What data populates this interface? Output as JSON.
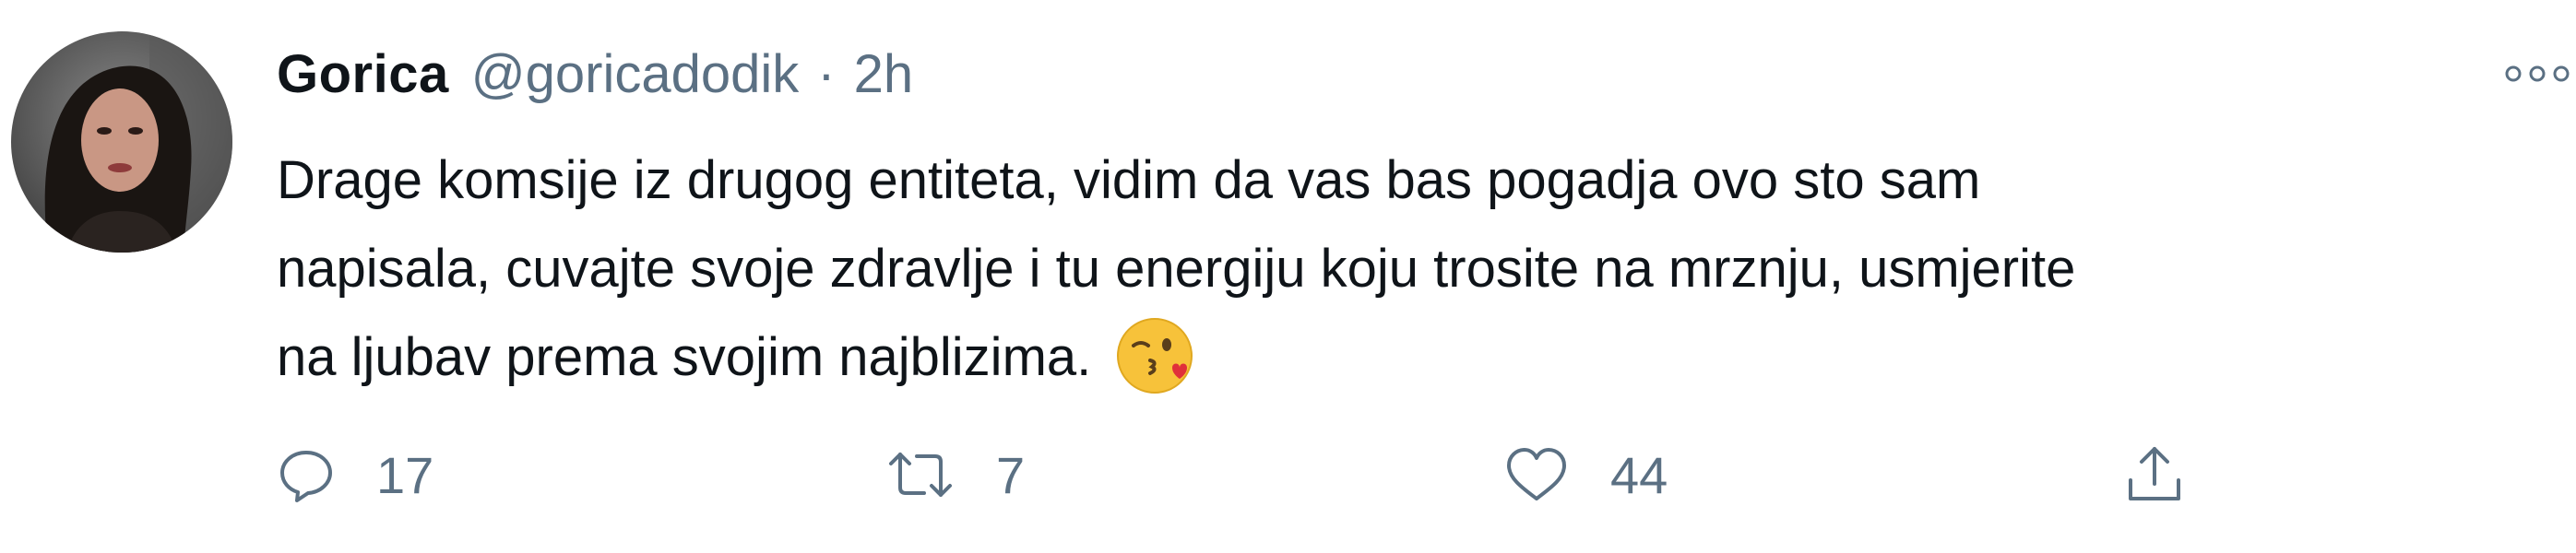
{
  "author": {
    "display_name": "Gorica",
    "handle": "@goricadodik",
    "separator": "·",
    "time": "2h"
  },
  "tweet": {
    "lines": [
      "Drage komsije iz drugog entiteta, vidim da vas bas pogadja ovo sto sam",
      "napisala, cuvajte svoje zdravlje i tu energiju koju trosite na mrznju, usmjerite",
      "na ljubav prema svojim najblizima."
    ],
    "emoji": "face-blowing-a-kiss"
  },
  "actions": {
    "reply_count": "17",
    "retweet_count": "7",
    "like_count": "44"
  },
  "icons": {
    "reply": "reply-icon",
    "retweet": "retweet-icon",
    "like": "heart-icon",
    "share": "share-icon",
    "more": "more-options-icon"
  },
  "colors": {
    "text_primary": "#0f1419",
    "text_secondary": "#5b7083"
  }
}
